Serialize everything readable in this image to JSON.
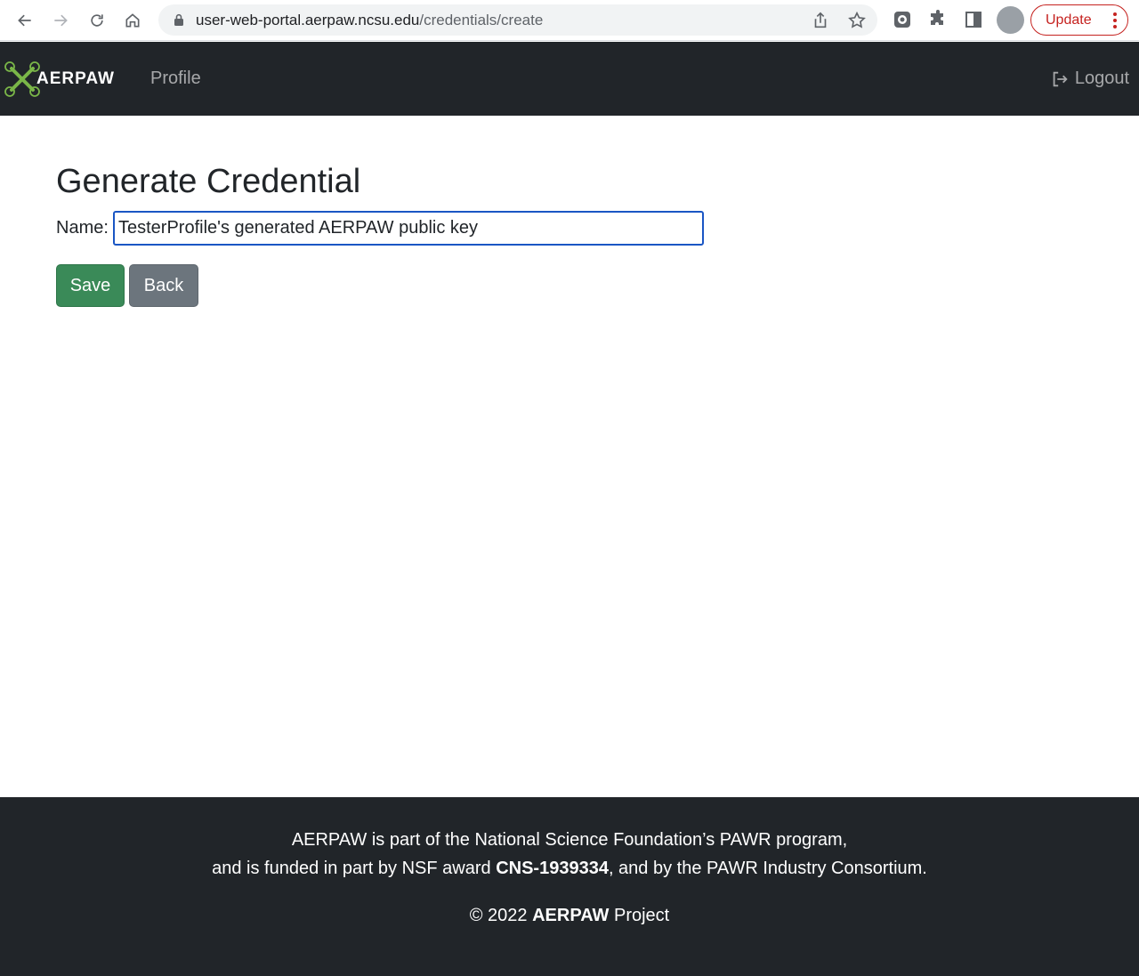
{
  "browser": {
    "url_host": "user-web-portal.aerpaw.ncsu.edu",
    "url_path": "/credentials/create",
    "update_label": "Update",
    "icons": [
      "back-arrow-icon",
      "forward-arrow-icon",
      "reload-icon",
      "home-icon",
      "lock-icon",
      "share-icon",
      "star-icon",
      "extension-icon",
      "puzzle-icon",
      "side-panel-icon",
      "more-vert-icon"
    ]
  },
  "navbar": {
    "brand": "AERPAW",
    "profile_link": "Profile",
    "logout_link": "Logout"
  },
  "main": {
    "title": "Generate Credential",
    "name_label": "Name:",
    "name_value": "TesterProfile's generated AERPAW public key",
    "save_label": "Save",
    "back_label": "Back"
  },
  "footer": {
    "line1": "AERPAW is part of the National Science Foundation’s PAWR program,",
    "line2_pre": "and is funded in part by NSF award ",
    "line2_award": "CNS-1939334",
    "line2_post": ", and by the PAWR Industry Consortium.",
    "line3_pre": "© 2022 ",
    "line3_brand": "AERPAW",
    "line3_post": " Project"
  },
  "colors": {
    "navbar_bg": "#212529",
    "save_btn": "#3a8a58",
    "back_btn": "#6c757d",
    "input_focus": "#1a56c4",
    "update_red": "#c5221f",
    "logo_green": "#7ab648"
  }
}
